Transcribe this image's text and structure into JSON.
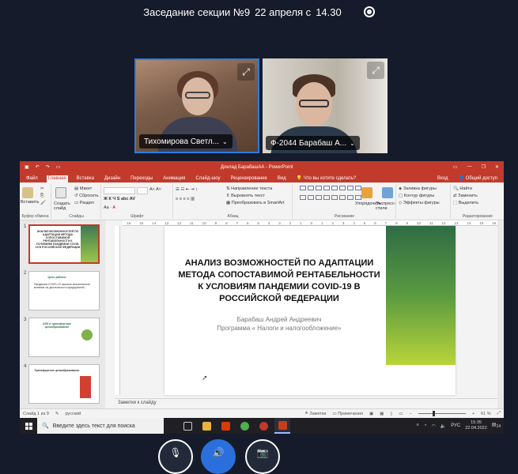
{
  "meeting": {
    "title": "Заседание секции №9",
    "date": "22 апреля с",
    "time": "14.30",
    "record_icon": "record-icon"
  },
  "participants": [
    {
      "name": "Тихомирова Светл...",
      "expand_icon": "expand-icon"
    },
    {
      "name": "Ф-2044 Барабаш А...",
      "expand_icon": "expand-icon"
    }
  ],
  "ppt": {
    "window_title": "Доклад БарабашАА - PowerPoint",
    "menu_tabs": [
      "Файл",
      "Главная",
      "Вставка",
      "Дизайн",
      "Переходы",
      "Анимация",
      "Слайд-шоу",
      "Рецензирование",
      "Вид"
    ],
    "active_tab": "Главная",
    "tell_me": "Что вы хотите сделать?",
    "signin": "Вход",
    "share": "Общий доступ",
    "ribbon": {
      "paste": "Вставить",
      "clipboard": "Буфер обмена",
      "new_slide": "Создать слайд",
      "layout": "Макет",
      "reset": "Сбросить",
      "section": "Раздел",
      "slides_group": "Слайды",
      "font_group": "Шрифт",
      "paragraph_group": "Абзац",
      "text_direction": "Направление текста",
      "align_text": "Выровнять текст",
      "smartart": "Преобразовать в SmartArt",
      "drawing_group": "Рисование",
      "arrange": "Упорядочить",
      "quick_styles": "Экспресс-стили",
      "shape_fill": "Заливка фигуры",
      "shape_outline": "Контур фигуры",
      "shape_effects": "Эффекты фигуры",
      "find": "Найти",
      "replace": "Заменить",
      "select": "Выделить",
      "editing_group": "Редактирование"
    },
    "ruler_marks": [
      "16",
      "15",
      "14",
      "13",
      "12",
      "11",
      "10",
      "9",
      "8",
      "7",
      "6",
      "5",
      "4",
      "3",
      "2",
      "1",
      "0",
      "1",
      "2",
      "3",
      "4",
      "5",
      "6",
      "7",
      "8",
      "9",
      "10",
      "11",
      "12",
      "13",
      "14",
      "15",
      "16"
    ],
    "thumbnails": [
      {
        "num": "1",
        "title": "АНАЛИЗ ВОЗМОЖНОСТЕЙ ПО АДАПТАЦИИ МЕТОДА СОПОСТАВИМОЙ РЕНТАБЕЛЬНОСТИ К УСЛОВИЯМ ПАНДЕМИИ COVID-19 В РОССИЙСКОЙ ФЕДЕРАЦИИ",
        "body": ""
      },
      {
        "num": "2",
        "title": "Цель работы",
        "body": "Пандемия COVID-19 оказала значительное влияние на деятельность предприятий..."
      },
      {
        "num": "3",
        "title": "ОЭЗ и трансфертное ценообразование",
        "body": ""
      },
      {
        "num": "4",
        "title": "Трансфертное ценообразование",
        "body": ""
      }
    ],
    "slide": {
      "title": "АНАЛИЗ ВОЗМОЖНОСТЕЙ ПО АДАПТАЦИИ МЕТОДА СОПОСТАВИМОЙ РЕНТАБЕЛЬНОСТИ К УСЛОВИЯМ ПАНДЕМИИ COVID-19 В РОССИЙСКОЙ ФЕДЕРАЦИИ",
      "author": "Барабаш Андрей Андреевич",
      "program": "Программа « Налоги и налогообложение»"
    },
    "notes_placeholder": "Заметки к слайду",
    "status": {
      "slide_of": "Слайд 1 из 9",
      "language": "русский",
      "notes": "Заметки",
      "comments": "Примечания",
      "zoom": "61 %",
      "zoom_level": 0.61
    }
  },
  "taskbar": {
    "search_placeholder": "Введите здесь текст для поиска",
    "language": "РУС",
    "time": "15:35",
    "date": "22.04.2022",
    "notification_count": "14"
  },
  "controls": {
    "mic_icon": "mic-off-icon",
    "speaker_icon": "speaker-icon",
    "camera_icon": "camera-off-icon"
  },
  "colors": {
    "ppt_accent": "#c23a2b",
    "active_tile_border": "#2a7de1",
    "background": "#151b2a"
  }
}
